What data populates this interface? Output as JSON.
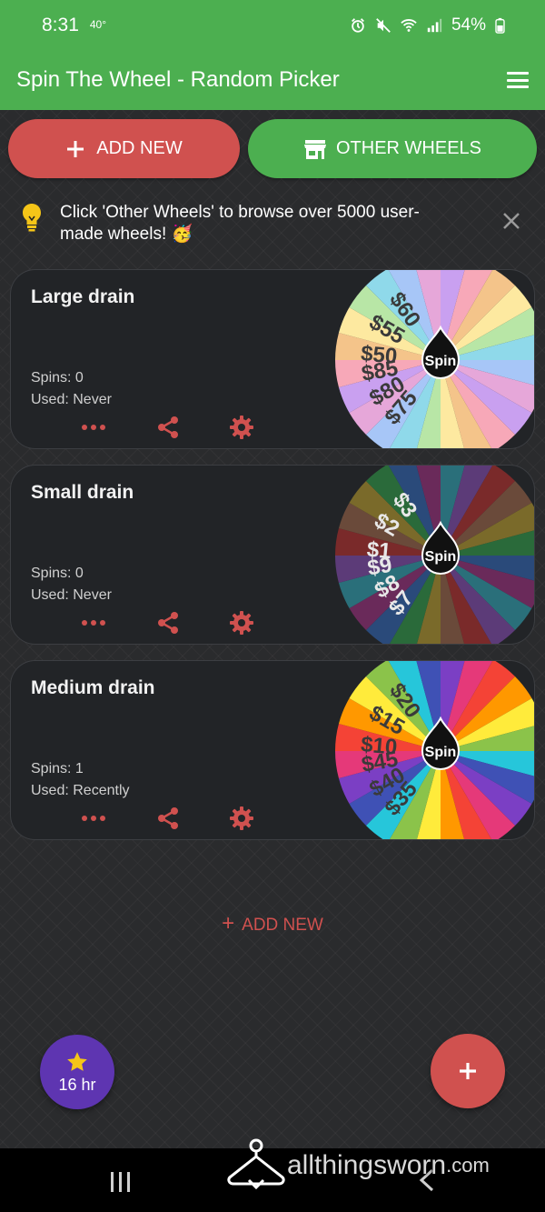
{
  "status_bar": {
    "time": "8:31",
    "temp": "40°",
    "battery": "54%"
  },
  "app_bar": {
    "title": "Spin The Wheel - Random Picker"
  },
  "actions": {
    "add_new": "ADD NEW",
    "other_wheels": "OTHER WHEELS"
  },
  "tip": {
    "text": "Click 'Other Wheels' to browse over 5000 user-made wheels! 🥳"
  },
  "wheels": [
    {
      "title": "Large drain",
      "spins": "Spins: 0",
      "used": "Used: Never",
      "spin_label": "Spin",
      "labels": [
        "$60",
        "$55",
        "$50",
        "$85",
        "$80",
        "$75"
      ],
      "colors": [
        "#c9a0f0",
        "#f7a8b8",
        "#f4c48a",
        "#fde9a0",
        "#b8e6a6",
        "#8fd9ea",
        "#a7c6f7",
        "#e6a7d9"
      ]
    },
    {
      "title": "Small drain",
      "spins": "Spins: 0",
      "used": "Used: Never",
      "spin_label": "Spin",
      "labels": [
        "$3",
        "$2",
        "$1",
        "$9",
        "$8",
        "$7"
      ],
      "colors": [
        "#2a6f7a",
        "#5c3b78",
        "#7a2a2a",
        "#6a4a3a",
        "#7a6a2a",
        "#2a6a3a",
        "#2a4a7a",
        "#6a2a5a"
      ]
    },
    {
      "title": "Medium drain",
      "spins": "Spins: 1",
      "used": "Used: Recently",
      "spin_label": "Spin",
      "labels": [
        "$20",
        "$15",
        "$10",
        "$45",
        "$40",
        "$35"
      ],
      "colors": [
        "#7b3fc4",
        "#e53979",
        "#f44336",
        "#ff9800",
        "#ffeb3b",
        "#8bc34a",
        "#26c6da",
        "#3f51b5"
      ]
    }
  ],
  "add_new_link": "ADD NEW",
  "fab_star": {
    "label": "16 hr"
  },
  "watermark": {
    "text": "allthingsworn",
    "suffix": ".com"
  }
}
